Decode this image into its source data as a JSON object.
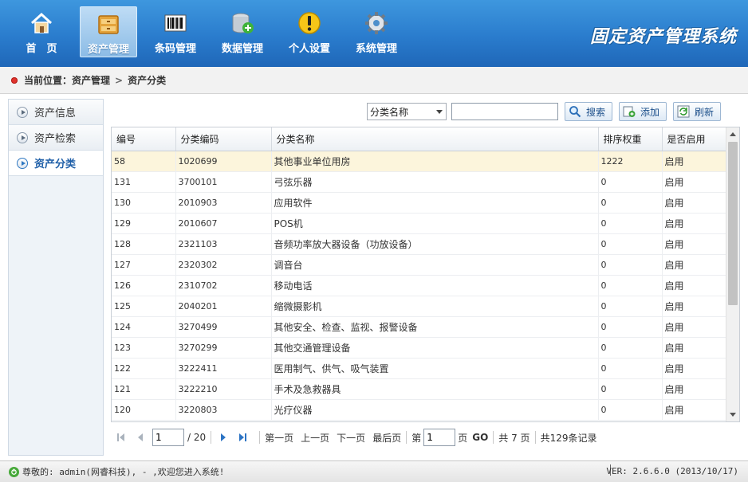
{
  "header": {
    "system_title": "固定资产管理系统",
    "nav": [
      {
        "label": "首　页",
        "icon": "home-icon"
      },
      {
        "label": "资产管理",
        "icon": "cabinet-icon",
        "active": true
      },
      {
        "label": "条码管理",
        "icon": "barcode-icon"
      },
      {
        "label": "数据管理",
        "icon": "database-icon"
      },
      {
        "label": "个人设置",
        "icon": "warning-icon"
      },
      {
        "label": "系统管理",
        "icon": "gear-icon"
      }
    ]
  },
  "breadcrumb": {
    "prefix": "当前位置：",
    "level1": "资产管理",
    "separator": ">",
    "level2": "资产分类"
  },
  "sidebar": {
    "items": [
      {
        "label": "资产信息"
      },
      {
        "label": "资产检索"
      },
      {
        "label": "资产分类",
        "active": true
      }
    ]
  },
  "toolbar": {
    "filter_selected": "分类名称",
    "search_value": "",
    "search_label": "搜索",
    "add_label": "添加",
    "refresh_label": "刷新"
  },
  "table": {
    "columns": [
      "编号",
      "分类编码",
      "分类名称",
      "排序权重",
      "是否启用"
    ],
    "rows": [
      [
        "58",
        "1020699",
        "其他事业单位用房",
        "1222",
        "启用"
      ],
      [
        "131",
        "3700101",
        "弓弦乐器",
        "0",
        "启用"
      ],
      [
        "130",
        "2010903",
        "应用软件",
        "0",
        "启用"
      ],
      [
        "129",
        "2010607",
        "POS机",
        "0",
        "启用"
      ],
      [
        "128",
        "2321103",
        "音频功率放大器设备（功放设备）",
        "0",
        "启用"
      ],
      [
        "127",
        "2320302",
        "调音台",
        "0",
        "启用"
      ],
      [
        "126",
        "2310702",
        "移动电话",
        "0",
        "启用"
      ],
      [
        "125",
        "2040201",
        "缩微摄影机",
        "0",
        "启用"
      ],
      [
        "124",
        "3270499",
        "其他安全、检查、监视、报警设备",
        "0",
        "启用"
      ],
      [
        "123",
        "3270299",
        "其他交通管理设备",
        "0",
        "启用"
      ],
      [
        "122",
        "3222411",
        "医用制气、供气、吸气装置",
        "0",
        "启用"
      ],
      [
        "121",
        "3222210",
        "手术及急救器具",
        "0",
        "启用"
      ],
      [
        "120",
        "3220803",
        "光疗仪器",
        "0",
        "启用"
      ]
    ]
  },
  "pager": {
    "current_page": "1",
    "total_pages_text": "/ 20",
    "prev_label": "上一页",
    "first_label": "第一页",
    "next_label": "下一页",
    "last_label": "最后页",
    "goto_prefix": "第",
    "goto_value": "1",
    "goto_suffix": "页",
    "go_label": "GO",
    "summary_pages": "共 7 页",
    "summary_records": "共129条记录"
  },
  "status": {
    "welcome": "尊敬的: admin(网睿科技), - ,欢迎您进入系统!",
    "version": "VER: 2.6.6.0 (2013/10/17)"
  },
  "colors": {
    "header_blue": "#2a7ccd",
    "selected_row": "#fcf5dc",
    "active_side": "#1f5fa8"
  }
}
